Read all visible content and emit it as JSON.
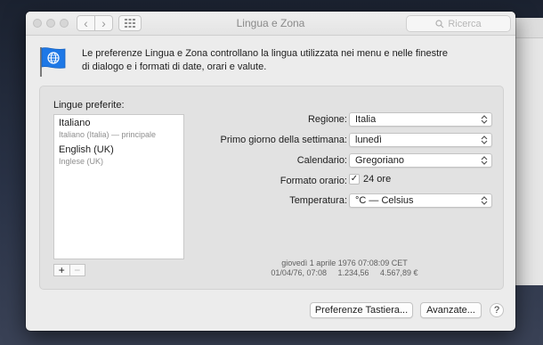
{
  "window": {
    "title": "Lingua e Zona",
    "search_placeholder": "Ricerca"
  },
  "intro": {
    "text": "Le preferenze Lingua e Zona controllano la lingua utilizzata nei menu e nelle finestre di dialogo e i formati di date, orari e valute."
  },
  "languages": {
    "heading": "Lingue preferite:",
    "items": [
      {
        "name": "Italiano",
        "detail": "Italiano (Italia) — principale"
      },
      {
        "name": "English (UK)",
        "detail": "Inglese (UK)"
      }
    ],
    "add_label": "+",
    "remove_label": "−"
  },
  "settings": {
    "region": {
      "label": "Regione:",
      "value": "Italia"
    },
    "first_day": {
      "label": "Primo giorno della settimana:",
      "value": "lunedì"
    },
    "calendar": {
      "label": "Calendario:",
      "value": "Gregoriano"
    },
    "time_format": {
      "label": "Formato orario:",
      "value": "24 ore",
      "checked": true
    },
    "temperature": {
      "label": "Temperatura:",
      "value": "°C — Celsius"
    }
  },
  "sample": {
    "line1": "giovedì 1 aprile 1976 07:08:09 CET",
    "line2": "01/04/76, 07:08     1.234,56     4.567,89 €"
  },
  "buttons": {
    "keyboard": "Preferenze Tastiera...",
    "advanced": "Avanzate...",
    "help": "?"
  },
  "colors": {
    "flag_blue": "#1e78e6",
    "window_bg": "#ececec"
  },
  "icons": [
    "back-icon",
    "forward-icon",
    "grid-icon",
    "search-icon",
    "globe-flag-icon",
    "chevron-updown-icon",
    "checkmark-icon"
  ]
}
